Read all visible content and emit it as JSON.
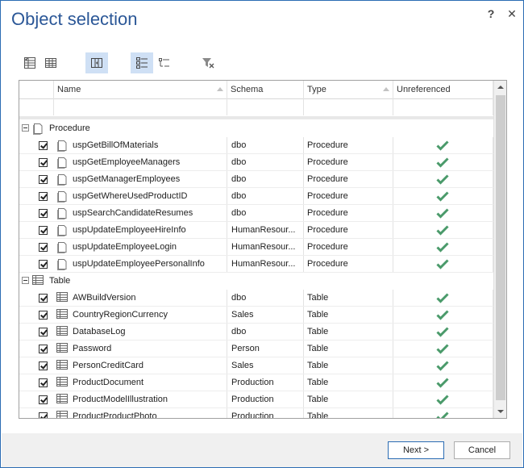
{
  "dialog": {
    "title": "Object selection",
    "help_label": "?",
    "close_label": "✕"
  },
  "toolbar": {
    "buttons": [
      {
        "icon": "check-list-icon",
        "active": false
      },
      {
        "icon": "table-grid-icon",
        "active": false
      },
      {
        "icon": "columns-chooser-icon",
        "active": true
      },
      {
        "icon": "group-by-icon",
        "active": true
      },
      {
        "icon": "flat-list-icon",
        "active": false
      },
      {
        "icon": "clear-filter-icon",
        "active": false
      }
    ]
  },
  "columns": {
    "name": "Name",
    "schema": "Schema",
    "type": "Type",
    "unreferenced": "Unreferenced"
  },
  "groups": {
    "procedure": {
      "label": "Procedure",
      "rows": [
        {
          "name": "uspGetBillOfMaterials",
          "schema": "dbo",
          "type": "Procedure"
        },
        {
          "name": "uspGetEmployeeManagers",
          "schema": "dbo",
          "type": "Procedure"
        },
        {
          "name": "uspGetManagerEmployees",
          "schema": "dbo",
          "type": "Procedure"
        },
        {
          "name": "uspGetWhereUsedProductID",
          "schema": "dbo",
          "type": "Procedure"
        },
        {
          "name": "uspSearchCandidateResumes",
          "schema": "dbo",
          "type": "Procedure"
        },
        {
          "name": "uspUpdateEmployeeHireInfo",
          "schema": "HumanResour...",
          "type": "Procedure"
        },
        {
          "name": "uspUpdateEmployeeLogin",
          "schema": "HumanResour...",
          "type": "Procedure"
        },
        {
          "name": "uspUpdateEmployeePersonalInfo",
          "schema": "HumanResour...",
          "type": "Procedure"
        }
      ]
    },
    "table": {
      "label": "Table",
      "rows": [
        {
          "name": "AWBuildVersion",
          "schema": "dbo",
          "type": "Table"
        },
        {
          "name": "CountryRegionCurrency",
          "schema": "Sales",
          "type": "Table"
        },
        {
          "name": "DatabaseLog",
          "schema": "dbo",
          "type": "Table"
        },
        {
          "name": "Password",
          "schema": "Person",
          "type": "Table"
        },
        {
          "name": "PersonCreditCard",
          "schema": "Sales",
          "type": "Table"
        },
        {
          "name": "ProductDocument",
          "schema": "Production",
          "type": "Table"
        },
        {
          "name": "ProductModelIllustration",
          "schema": "Production",
          "type": "Table"
        },
        {
          "name": "ProductProductPhoto",
          "schema": "Production",
          "type": "Table"
        }
      ]
    }
  },
  "footer": {
    "next_label": "Next >",
    "cancel_label": "Cancel"
  },
  "colors": {
    "title": "#2b5797",
    "check": "#4a9a6a",
    "active_button": "#cfe0f5"
  }
}
